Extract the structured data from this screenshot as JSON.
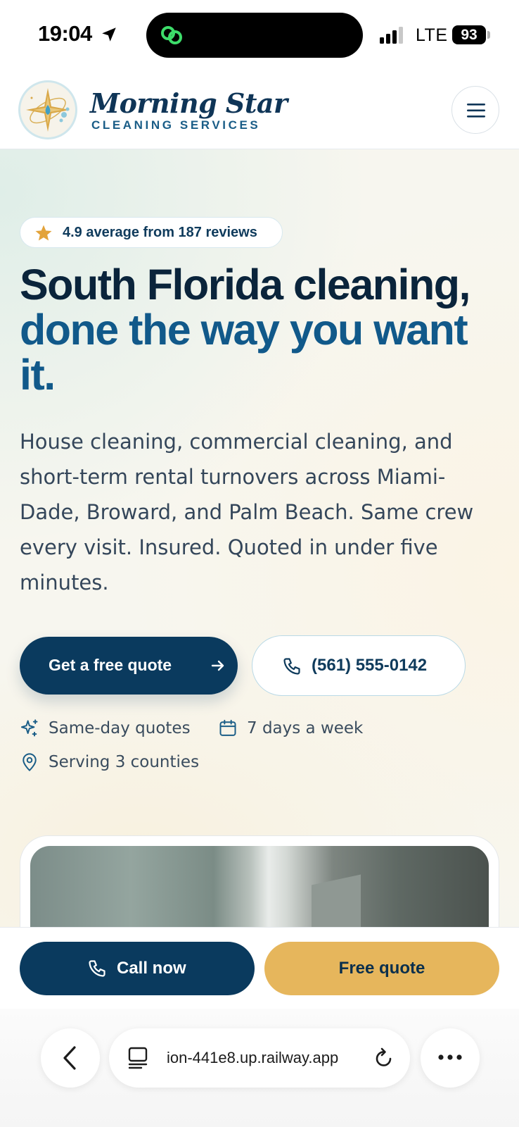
{
  "status_bar": {
    "time": "19:04",
    "network": "LTE",
    "battery": "93"
  },
  "header": {
    "brand_name": "Morning Star",
    "brand_tagline": "CLEANING SERVICES"
  },
  "hero": {
    "rating_text": "4.9 average from 187 reviews",
    "headline_line1": "South Florida cleaning,",
    "headline_line2": "done the way you want it.",
    "description": "House cleaning, commercial cleaning, and short-term rental turnovers across Miami-Dade, Broward, and Palm Beach. Same crew every visit. Insured. Quoted in under five minutes.",
    "primary_cta": "Get a free quote",
    "phone_cta": "(561) 555-0142",
    "features": {
      "quotes": "Same-day quotes",
      "days": "7 days a week",
      "counties": "Serving 3 counties"
    }
  },
  "sticky_bar": {
    "call_label": "Call now",
    "quote_label": "Free quote"
  },
  "browser": {
    "url": "ion-441e8.up.railway.app"
  },
  "colors": {
    "navy": "#0a3a5e",
    "headline_blue": "#11598a",
    "gold": "#e6b65c"
  }
}
